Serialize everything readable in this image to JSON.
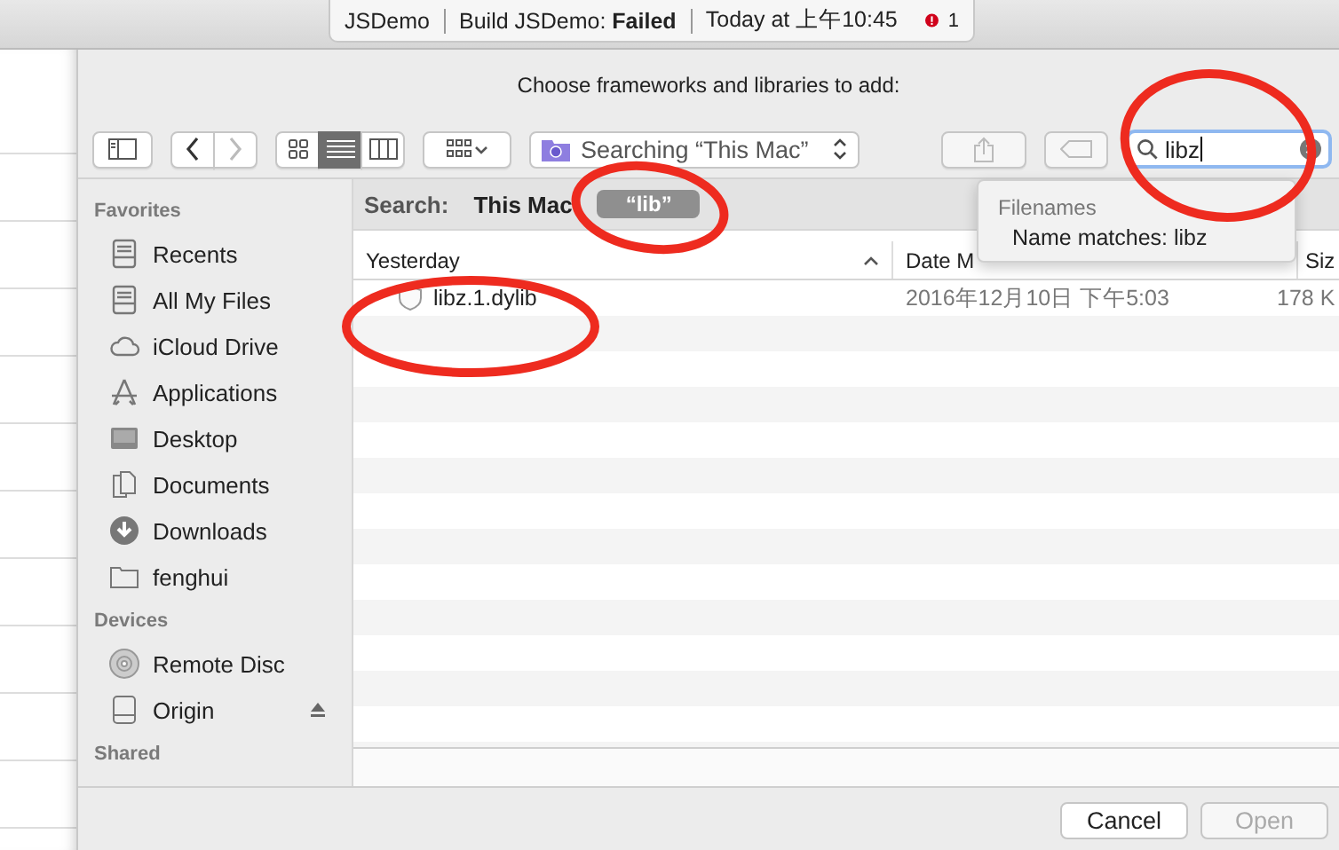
{
  "activity": {
    "project": "JSDemo",
    "status": "Build JSDemo: **Failed**",
    "time": "Today at 上午10:45",
    "error_count": "1"
  },
  "dialog": {
    "title": "Choose frameworks and libraries to add:",
    "toolbar": {
      "view_modes": [
        {
          "kind": "icons",
          "selected": false
        },
        {
          "kind": "list",
          "selected": true
        },
        {
          "kind": "columns",
          "selected": false
        }
      ],
      "location": "Searching “This Mac”",
      "search": {
        "value": "libz"
      }
    },
    "sidebar": {
      "sections": [
        {
          "heading": "Favorites",
          "items": [
            {
              "label": "Recents",
              "kind": "tray"
            },
            {
              "label": "All My Files",
              "kind": "tray"
            },
            {
              "label": "iCloud Drive",
              "kind": "cloud"
            },
            {
              "label": "Applications",
              "kind": "apps"
            },
            {
              "label": "Desktop",
              "kind": "desktop"
            },
            {
              "label": "Documents",
              "kind": "docs"
            },
            {
              "label": "Downloads",
              "kind": "download"
            },
            {
              "label": "fenghui",
              "kind": "folder"
            }
          ]
        },
        {
          "heading": "Devices",
          "items": [
            {
              "label": "Remote Disc",
              "kind": "disc",
              "ejectable": false
            },
            {
              "label": "Origin",
              "kind": "drive",
              "ejectable": true
            }
          ]
        },
        {
          "heading": "Shared"
        }
      ]
    },
    "scope_bar": {
      "label": "Search:",
      "scopes": [
        {
          "label": "This Mac",
          "kind": "scope"
        },
        {
          "label": "“lib”",
          "kind": "token"
        }
      ]
    },
    "columns": [
      {
        "label": "Yesterday",
        "sorted": true
      },
      {
        "label": "Date M",
        "sorted": false
      },
      {
        "label": "Siz",
        "sorted": false
      }
    ],
    "rows": [
      {
        "name": "libz.1.dylib",
        "date": "2016年12月10日 下午5:03",
        "size": "178 K"
      }
    ],
    "suggestions": {
      "heading": "Filenames",
      "items": [
        "Name matches: libz"
      ]
    },
    "buttons": [
      {
        "label": "Cancel",
        "disabled": false
      },
      {
        "label": "Open",
        "disabled": true
      }
    ]
  }
}
